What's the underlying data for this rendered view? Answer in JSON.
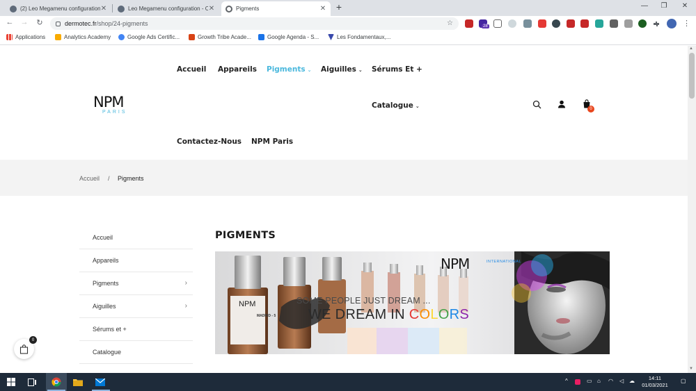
{
  "browser": {
    "tabs": [
      {
        "title": "(2) Leo Megamenu configuration",
        "favicon_color": "#5f6b7a",
        "active": false
      },
      {
        "title": "Leo Megamenu configuration - C",
        "favicon_color": "#5f6b7a",
        "active": false
      },
      {
        "title": "Pigments",
        "favicon_color": "#5f6368",
        "active": true
      }
    ],
    "new_tab": "+",
    "window_controls": {
      "minimize": "—",
      "restore": "❐",
      "close": "✕"
    },
    "nav": {
      "back": "←",
      "forward": "→",
      "reload": "↻"
    },
    "address": {
      "host": "dermotec.fr",
      "path": "/shop/24-pigments"
    },
    "bookmarks": [
      {
        "label": "Applications",
        "icon_color": "#ea4335"
      },
      {
        "label": "Analytics Academy",
        "icon_color": "#f9ab00"
      },
      {
        "label": "Google Ads Certific...",
        "icon_color": "#4285f4"
      },
      {
        "label": "Growth Tribe Acade...",
        "icon_color": "#d84315"
      },
      {
        "label": "Google Agenda - S...",
        "icon_color": "#1a73e8"
      },
      {
        "label": "Les Fondamentaux,...",
        "icon_color": "#3949ab"
      }
    ],
    "extension_badge": "28"
  },
  "site": {
    "logo": {
      "main": "NPM",
      "sub": "PARIS"
    },
    "nav": [
      {
        "label": "Accueil",
        "active": false,
        "dropdown": false
      },
      {
        "label": "Appareils",
        "active": false,
        "dropdown": false
      },
      {
        "label": "Pigments",
        "active": true,
        "dropdown": true
      },
      {
        "label": "Aiguilles",
        "active": false,
        "dropdown": true
      },
      {
        "label": "Sérums Et +",
        "active": false,
        "dropdown": false
      },
      {
        "label": "Catalogue",
        "active": false,
        "dropdown": true
      },
      {
        "label": "Contactez-Nous",
        "active": false,
        "dropdown": false
      },
      {
        "label": "NPM Paris",
        "active": false,
        "dropdown": false
      }
    ],
    "cart_count": "0",
    "breadcrumb": {
      "home": "Accueil",
      "separator": "/",
      "current": "Pigments"
    },
    "sidebar": [
      {
        "label": "Accueil",
        "has_children": false
      },
      {
        "label": "Appareils",
        "has_children": false
      },
      {
        "label": "Pigments",
        "has_children": true
      },
      {
        "label": "Aiguilles",
        "has_children": true
      },
      {
        "label": "Sérums et +",
        "has_children": false
      },
      {
        "label": "Catalogue",
        "has_children": false
      }
    ],
    "page_title": "PIGMENTS",
    "banner": {
      "logo": "NPM",
      "logo_sub": "INTERNATIONAL",
      "tagline_1": "SOME PEOPLE JUST DREAM ...",
      "tagline_2_prefix": "WE DREAM IN ",
      "tagline_2_colors": "COLORS",
      "bottle_label": "NPM",
      "bottle_text": "MADRID - 5",
      "colors_letters": [
        {
          "char": "C",
          "color": "#e53935"
        },
        {
          "char": "O",
          "color": "#fb8c00"
        },
        {
          "char": "L",
          "color": "#fdd835"
        },
        {
          "char": "O",
          "color": "#43a047"
        },
        {
          "char": "R",
          "color": "#1e88e5"
        },
        {
          "char": "S",
          "color": "#8e24aa"
        }
      ]
    },
    "floating_cart_count": "0"
  },
  "taskbar": {
    "time": "14:11",
    "date": "01/03/2021"
  }
}
